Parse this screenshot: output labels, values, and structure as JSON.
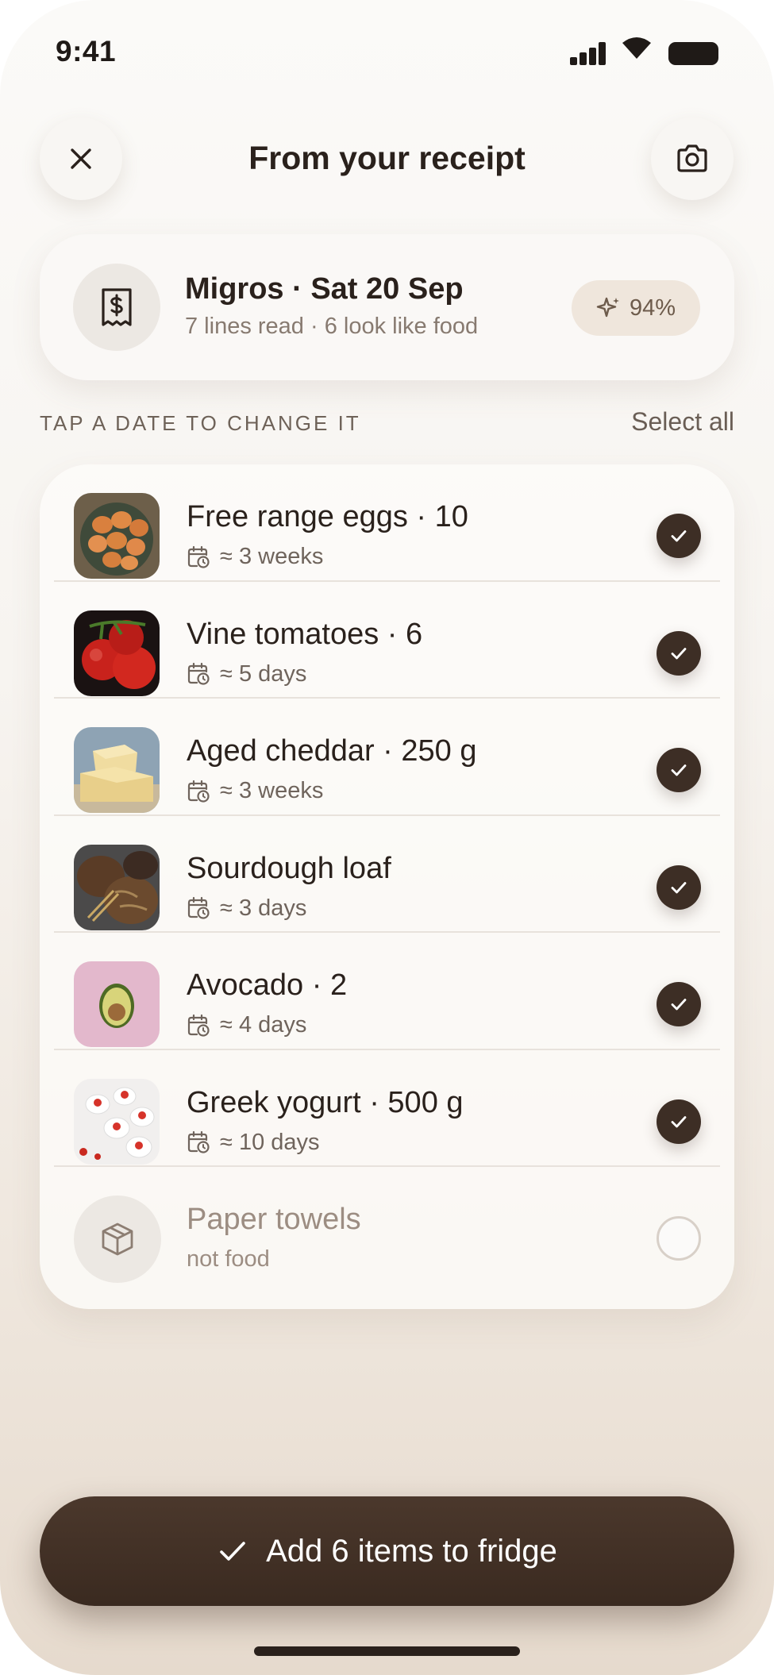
{
  "status_bar": {
    "time": "9:41"
  },
  "header": {
    "title": "From your receipt",
    "close_icon": "close-icon",
    "camera_icon": "camera-icon"
  },
  "receipt": {
    "store_date": "Migros · Sat 20 Sep",
    "summary": "7 lines read · 6 look like food",
    "confidence": "94%",
    "icon": "receipt-icon",
    "confidence_icon": "sparkle-icon"
  },
  "section": {
    "label": "TAP A DATE TO CHANGE IT",
    "select_all": "Select all"
  },
  "items": [
    {
      "name": "Free range eggs · 10",
      "meta": "≈ 3 weeks",
      "checked": true
    },
    {
      "name": "Vine tomatoes · 6",
      "meta": "≈ 5 days",
      "checked": true
    },
    {
      "name": "Aged cheddar · 250 g",
      "meta": "≈ 3 weeks",
      "checked": true
    },
    {
      "name": "Sourdough loaf",
      "meta": "≈ 3 days",
      "checked": true
    },
    {
      "name": "Avocado · 2",
      "meta": "≈ 4 days",
      "checked": true
    },
    {
      "name": "Greek yogurt · 500 g",
      "meta": "≈ 10 days",
      "checked": true
    },
    {
      "name": "Paper towels",
      "meta": "not food",
      "checked": false
    }
  ],
  "cta": {
    "label": "Add 6 items to fridge"
  },
  "colors": {
    "accent": "#3d2e25",
    "muted_text": "#9c8d82",
    "confidence_bg": "#efe6dc"
  }
}
